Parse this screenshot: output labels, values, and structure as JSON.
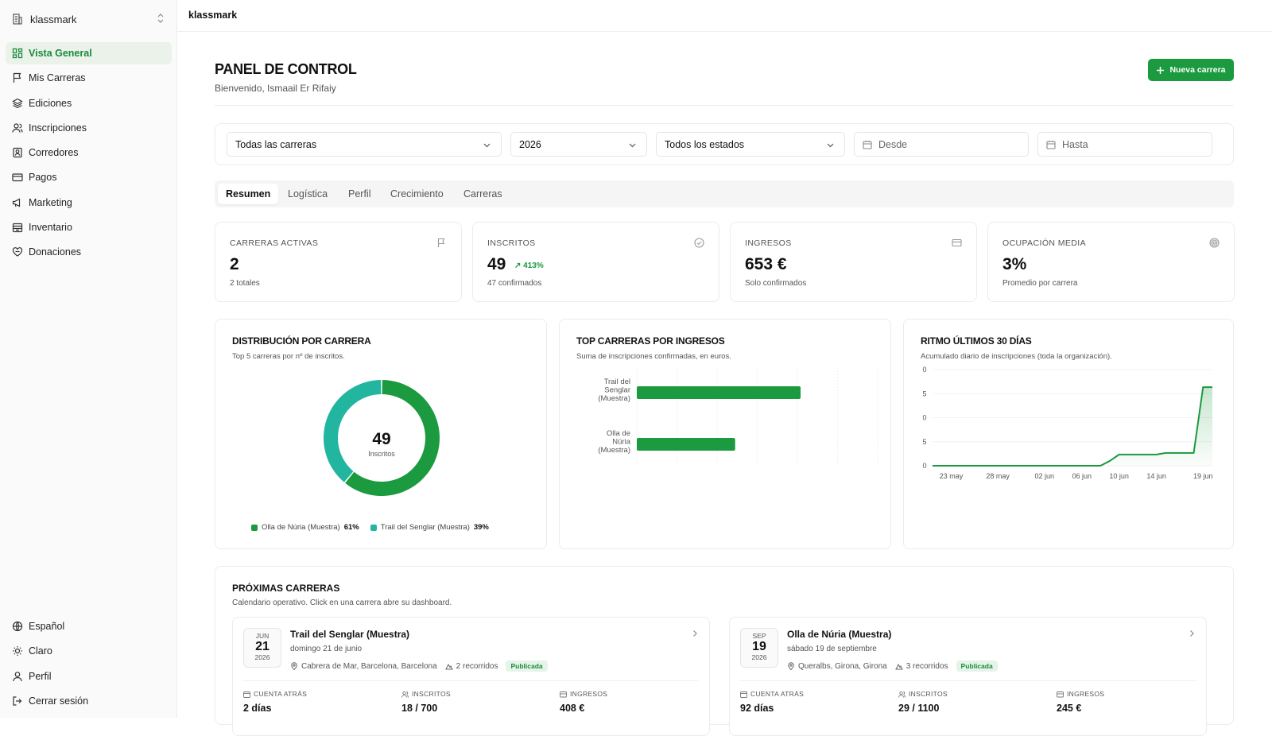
{
  "sidebar": {
    "org_name": "klassmark",
    "items": [
      {
        "label": "Vista General",
        "icon": "grid-icon"
      },
      {
        "label": "Mis Carreras",
        "icon": "flag-icon"
      },
      {
        "label": "Ediciones",
        "icon": "layers-icon"
      },
      {
        "label": "Inscripciones",
        "icon": "users-icon"
      },
      {
        "label": "Corredores",
        "icon": "id-badge-icon"
      },
      {
        "label": "Pagos",
        "icon": "credit-card-icon"
      },
      {
        "label": "Marketing",
        "icon": "megaphone-icon"
      },
      {
        "label": "Inventario",
        "icon": "box-icon"
      },
      {
        "label": "Donaciones",
        "icon": "heart-hand-icon"
      }
    ],
    "bottom": [
      {
        "label": "Español",
        "icon": "globe-icon"
      },
      {
        "label": "Claro",
        "icon": "sun-icon"
      },
      {
        "label": "Perfil",
        "icon": "user-icon"
      },
      {
        "label": "Cerrar sesión",
        "icon": "logout-icon"
      }
    ]
  },
  "topbar": {
    "title": "klassmark"
  },
  "header": {
    "title": "PANEL DE CONTROL",
    "welcome": "Bienvenido, Ismaail Er Rifaiy",
    "new_button": "Nueva carrera"
  },
  "filters": {
    "race": "Todas las carreras",
    "year": "2026",
    "status": "Todos los estados",
    "from": "Desde",
    "to": "Hasta"
  },
  "tabs": [
    "Resumen",
    "Logística",
    "Perfil",
    "Crecimiento",
    "Carreras"
  ],
  "kpis": [
    {
      "label": "CARRERAS ACTIVAS",
      "value": "2",
      "sub": "2 totales",
      "icon": "flag-icon"
    },
    {
      "label": "INSCRITOS",
      "value": "49",
      "delta": "413%",
      "sub": "47 confirmados",
      "icon": "check-circle-icon"
    },
    {
      "label": "INGRESOS",
      "value": "653 €",
      "sub": "Solo confirmados",
      "icon": "credit-card-icon"
    },
    {
      "label": "OCUPACIÓN MEDIA",
      "value": "3%",
      "sub": "Promedio por carrera",
      "icon": "target-icon"
    }
  ],
  "colors": {
    "accent": "#1b9a3f",
    "teal": "#22b5a0"
  },
  "chart_data": [
    {
      "type": "pie",
      "title": "DISTRIBUCIÓN POR CARRERA",
      "subtitle": "Top 5 carreras por nº de inscritos.",
      "center_value": "49",
      "center_label": "Inscritos",
      "categories": [
        "Olla de Núria (Muestra)",
        "Trail del Senglar (Muestra)"
      ],
      "values": [
        61,
        39
      ],
      "value_labels": [
        "61%",
        "39%"
      ],
      "colors": [
        "#1b9a3f",
        "#22b5a0"
      ]
    },
    {
      "type": "bar",
      "orientation": "horizontal",
      "title": "TOP CARRERAS POR INGRESOS",
      "subtitle": "Suma de inscripciones confirmadas, en euros.",
      "categories": [
        [
          "Trail del",
          "Senglar",
          "(Muestra)"
        ],
        [
          "Olla de",
          "Núria",
          "(Muestra)"
        ]
      ],
      "values": [
        408,
        245
      ],
      "xlim": [
        0,
        600
      ],
      "grid": true
    },
    {
      "type": "area",
      "title": "RITMO ÚLTIMOS 30 DÍAS",
      "subtitle": "Acumulado diario de inscripciones (toda la organización).",
      "x_ticks": [
        "23 may",
        "28 may",
        "02 jun",
        "06 jun",
        "10 jun",
        "14 jun",
        "19 jun"
      ],
      "y_tick_labels": [
        "0",
        "5",
        "0",
        "5",
        "0"
      ],
      "ylim": [
        0,
        60
      ],
      "series": [
        {
          "x": [
            "21 may",
            "22 may",
            "23 may",
            "24 may",
            "25 may",
            "26 may",
            "27 may",
            "28 may",
            "29 may",
            "30 may",
            "31 may",
            "01 jun",
            "02 jun",
            "03 jun",
            "04 jun",
            "05 jun",
            "06 jun",
            "07 jun",
            "08 jun",
            "09 jun",
            "10 jun",
            "11 jun",
            "12 jun",
            "13 jun",
            "14 jun",
            "15 jun",
            "16 jun",
            "17 jun",
            "18 jun",
            "19 jun",
            "20 jun"
          ],
          "values": [
            0,
            0,
            0,
            0,
            0,
            0,
            0,
            0,
            0,
            0,
            0,
            0,
            0,
            0,
            0,
            0,
            0,
            0,
            0,
            3,
            7,
            7,
            7,
            7,
            7,
            8,
            8,
            8,
            8,
            49,
            49
          ]
        }
      ]
    }
  ],
  "upcoming": {
    "title": "PRÓXIMAS CARRERAS",
    "subtitle": "Calendario operativo. Click en una carrera abre su dashboard.",
    "races": [
      {
        "month": "JUN",
        "day": "21",
        "year": "2026",
        "name": "Trail del Senglar (Muestra)",
        "date": "domingo 21 de junio",
        "location": "Cabrera de Mar, Barcelona, Barcelona",
        "routes": "2 recorridos",
        "status": "Publicada",
        "countdown_label": "CUENTA ATRÁS",
        "countdown": "2 días",
        "inscritos_label": "INSCRITOS",
        "inscritos": "18 / 700",
        "ingresos_label": "INGRESOS",
        "ingresos": "408 €"
      },
      {
        "month": "SEP",
        "day": "19",
        "year": "2026",
        "name": "Olla de Núria (Muestra)",
        "date": "sábado 19 de septiembre",
        "location": "Queralbs, Girona, Girona",
        "routes": "3 recorridos",
        "status": "Publicada",
        "countdown_label": "CUENTA ATRÁS",
        "countdown": "92 días",
        "inscritos_label": "INSCRITOS",
        "inscritos": "29 / 1100",
        "ingresos_label": "INGRESOS",
        "ingresos": "245 €"
      }
    ]
  }
}
